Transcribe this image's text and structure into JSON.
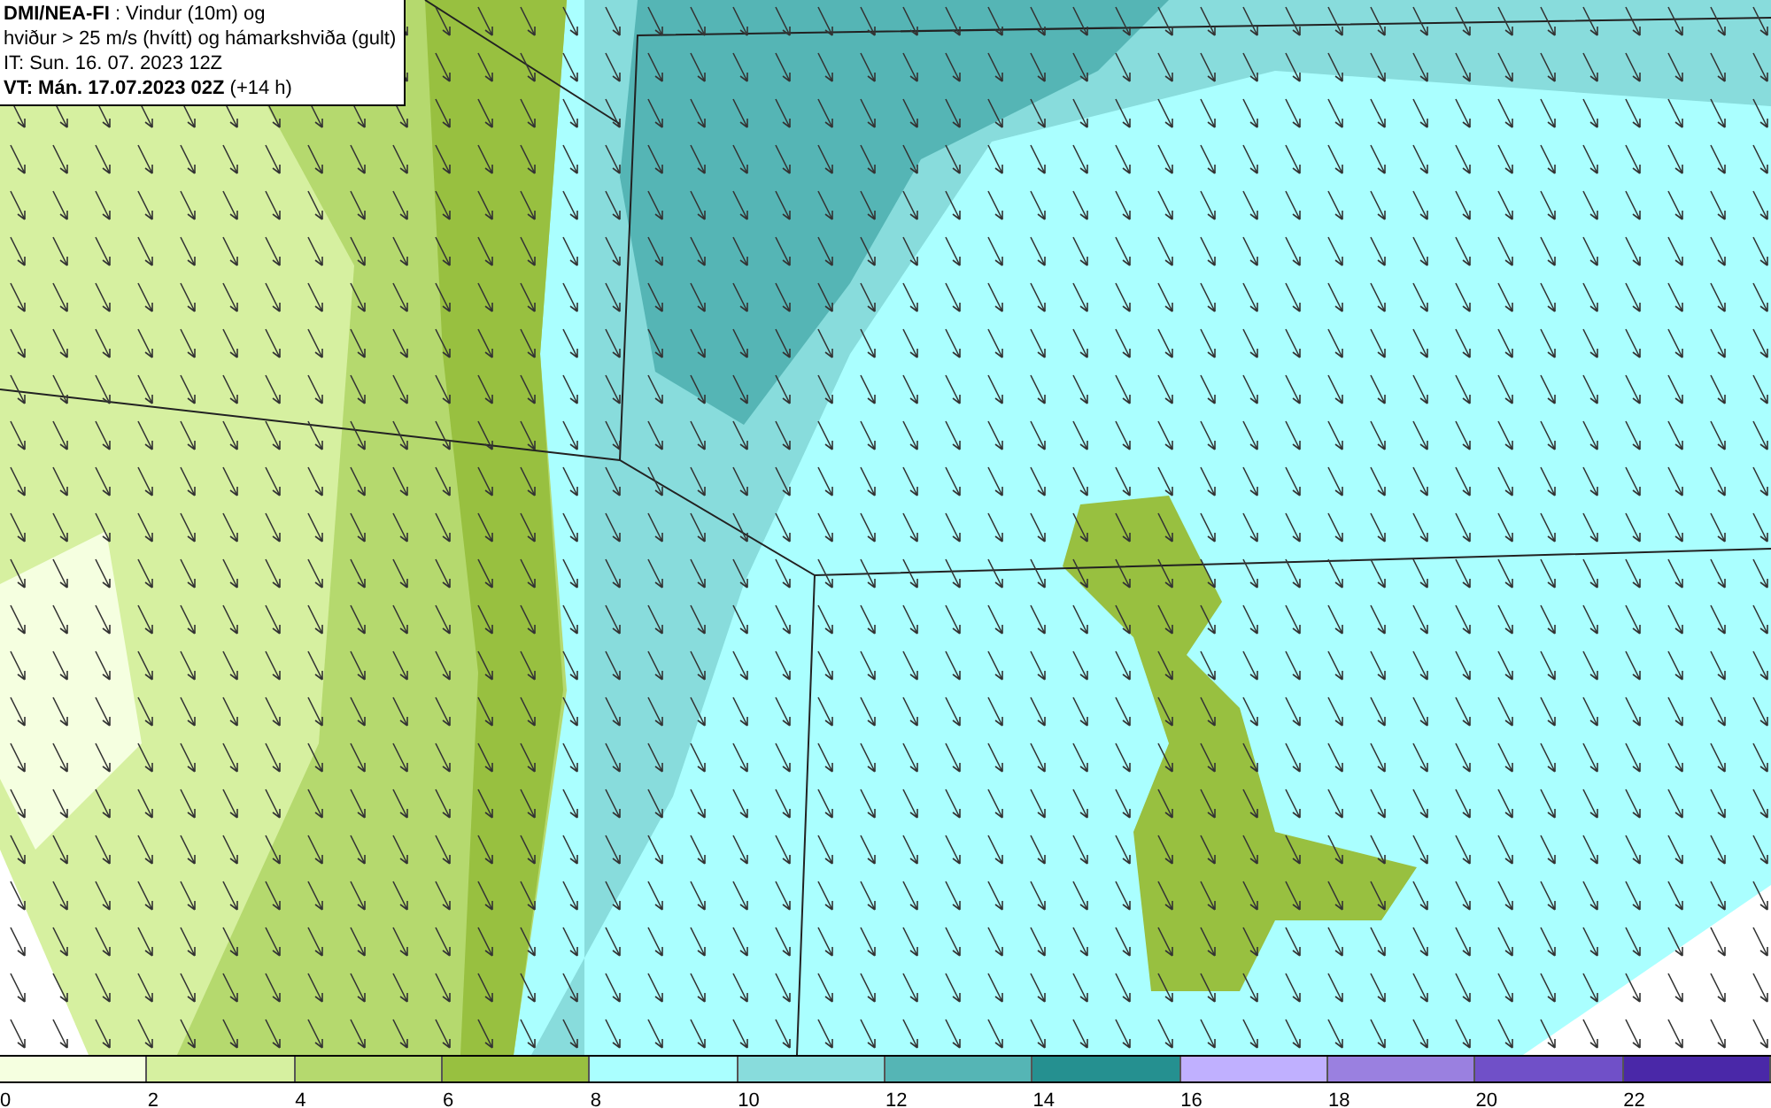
{
  "info_box": {
    "lines": [
      "**DMI/NEA-FI** : Vindur (10m) og",
      "hviður > 25 m/s (hvítt) og hámarkshviða (gult)",
      "IT: Sun. 16. 07. 2023 12Z",
      "**VT: Mán. 17.07.2023 02Z** (+14 h)"
    ]
  },
  "color_scale": [
    {
      "label": "0",
      "color": "#f5ffe0"
    },
    {
      "label": "2",
      "color": "#d6f0a0"
    },
    {
      "label": "4",
      "color": "#b5d96e"
    },
    {
      "label": "6",
      "color": "#98c040"
    },
    {
      "label": "8",
      "color": "#aaffff"
    },
    {
      "label": "10",
      "color": "#88dcdc"
    },
    {
      "label": "12",
      "color": "#55b5b5"
    },
    {
      "label": "14",
      "color": "#259090"
    },
    {
      "label": "16",
      "color": "#c0b0ff"
    },
    {
      "label": "18",
      "color": "#9a80e0"
    },
    {
      "label": "20",
      "color": "#7050c8"
    },
    {
      "label": "22",
      "color": "#4a28a8"
    }
  ]
}
